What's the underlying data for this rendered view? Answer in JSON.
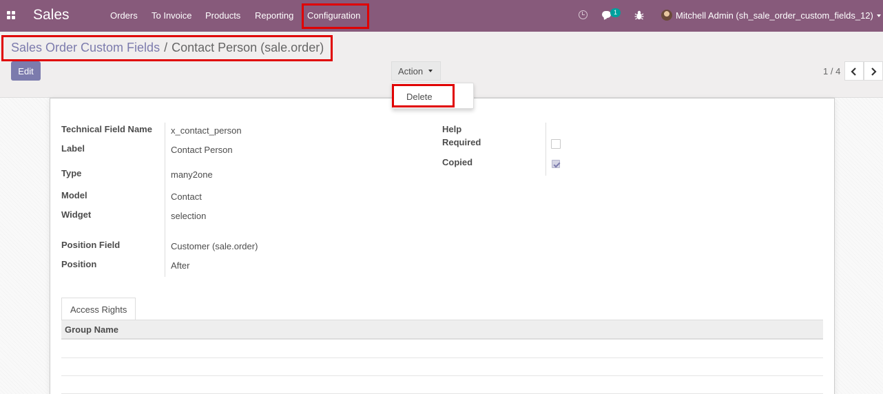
{
  "navbar": {
    "app_title": "Sales",
    "menu": [
      "Orders",
      "To Invoice",
      "Products",
      "Reporting",
      "Configuration"
    ],
    "chat_badge": "1",
    "user": "Mitchell Admin (sh_sale_order_custom_fields_12)",
    "icons": [
      "apps-icon",
      "clock-icon",
      "chat-icon",
      "bug-icon",
      "avatar"
    ]
  },
  "breadcrumb": {
    "parent": "Sales Order Custom Fields",
    "separator": "/",
    "current": "Contact Person (sale.order)"
  },
  "toolbar": {
    "edit_label": "Edit",
    "action_label": "Action",
    "pager": "1 / 4"
  },
  "dropdown": {
    "items": [
      "Delete"
    ]
  },
  "form": {
    "left": [
      {
        "label": "Technical Field Name",
        "value": "x_contact_person"
      },
      {
        "label": "Label",
        "value": "Contact Person"
      },
      {
        "label": "Type",
        "value": "many2one"
      },
      {
        "label": "Model",
        "value": "Contact"
      },
      {
        "label": "Widget",
        "value": "selection"
      },
      {
        "label": "Position Field",
        "value": "Customer (sale.order)"
      },
      {
        "label": "Position",
        "value": "After"
      }
    ],
    "right": [
      {
        "label": "Help"
      },
      {
        "label": "Required",
        "checked": false
      },
      {
        "label": "Copied",
        "checked": true
      }
    ]
  },
  "tabs": [
    "Access Rights"
  ],
  "table": {
    "columns": [
      "Group Name"
    ]
  },
  "colors": {
    "navbar": "#875a7b",
    "accent": "#7c7bad",
    "highlight": "#e00000",
    "badge": "#00a09d"
  }
}
